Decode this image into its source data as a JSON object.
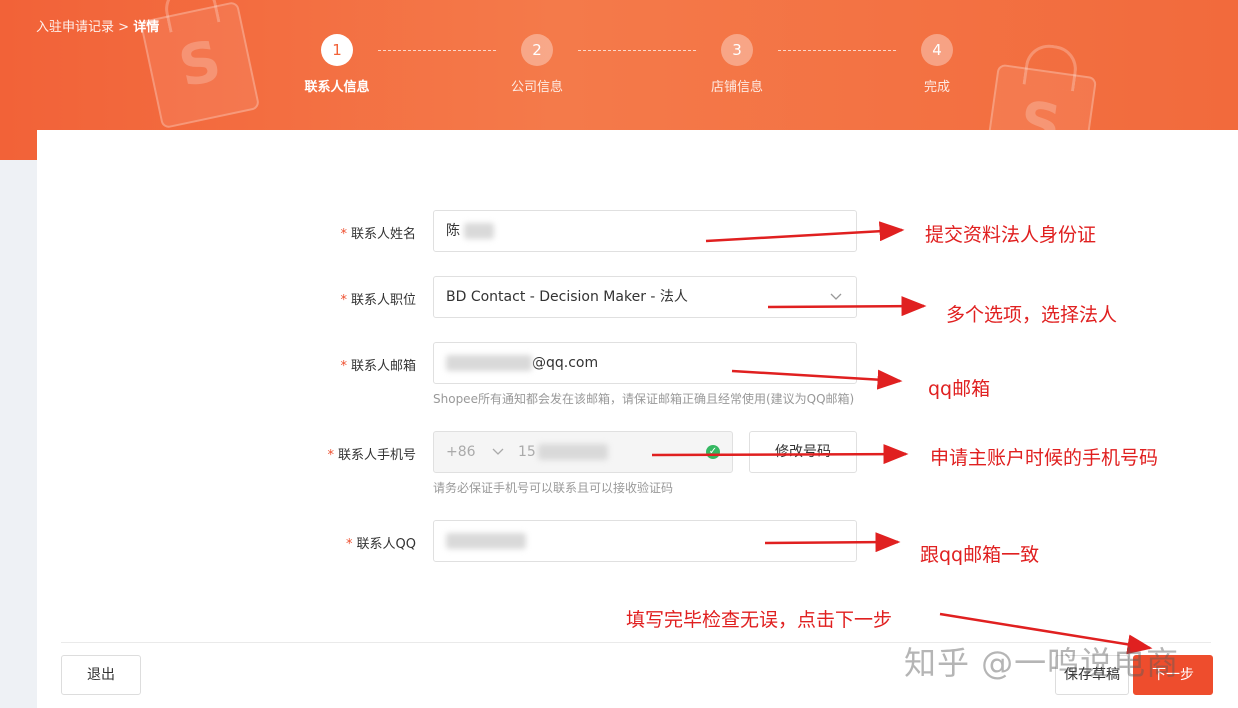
{
  "breadcrumb": {
    "parent": "入驻申请记录",
    "separator": ">",
    "current": "详情"
  },
  "steps": [
    {
      "number": "1",
      "label": "联系人信息",
      "active": true
    },
    {
      "number": "2",
      "label": "公司信息",
      "active": false
    },
    {
      "number": "3",
      "label": "店铺信息",
      "active": false
    },
    {
      "number": "4",
      "label": "完成",
      "active": false
    }
  ],
  "form": {
    "required_mark": "*",
    "name": {
      "label": "联系人姓名",
      "value": "陈"
    },
    "position": {
      "label": "联系人职位",
      "value": "BD Contact - Decision Maker - 法人"
    },
    "email": {
      "label": "联系人邮箱",
      "value": "@qq.com",
      "hint": "Shopee所有通知都会发在该邮箱，请保证邮箱正确且经常使用(建议为QQ邮箱)"
    },
    "phone": {
      "label": "联系人手机号",
      "country_code": "+86",
      "value": "15",
      "modify_button": "修改号码",
      "hint": "请务必保证手机号可以联系且可以接收验证码"
    },
    "qq": {
      "label": "联系人QQ",
      "value": ""
    }
  },
  "footer": {
    "exit_label": "退出",
    "save_draft_label": "保存草稿",
    "next_label": "下一步"
  },
  "annotations": {
    "name": "提交资料法人身份证",
    "position": "多个选项，选择法人",
    "email": "qq邮箱",
    "phone": "申请主账户时候的手机号码",
    "qq": "跟qq邮箱一致",
    "next": "填写完毕检查无误，点击下一步"
  },
  "watermark": "知乎 @一鸣说电商",
  "colors": {
    "brand": "#ee4d2d",
    "banner": "#f26238",
    "annotation": "#e02020",
    "verified": "#35b862"
  },
  "icons": {
    "dropdown": "chevron-down-icon",
    "verified": "check-circle-icon"
  }
}
